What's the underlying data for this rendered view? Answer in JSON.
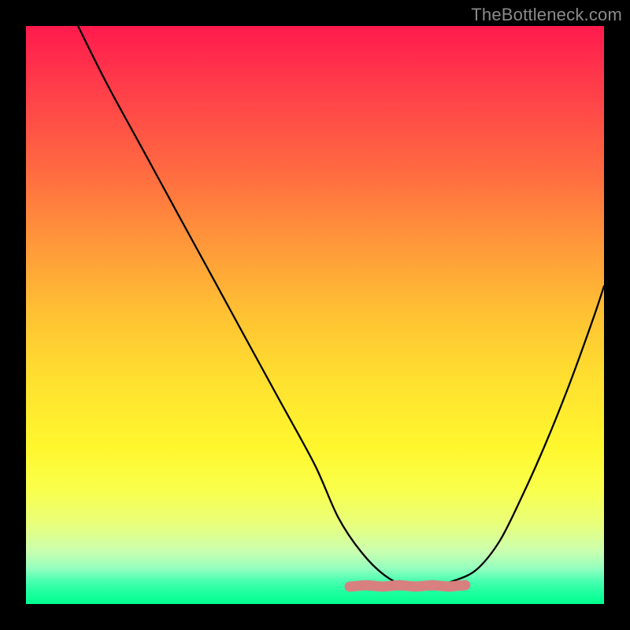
{
  "watermark": "TheBottleneck.com",
  "chart_data": {
    "type": "line",
    "title": "",
    "xlabel": "",
    "ylabel": "",
    "xlim": [
      0,
      100
    ],
    "ylim": [
      0,
      100
    ],
    "grid": false,
    "series": [
      {
        "name": "bottleneck-curve",
        "x": [
          9,
          14,
          20,
          26,
          32,
          38,
          44,
          50,
          54,
          58,
          62,
          66,
          70,
          74,
          78,
          82,
          86,
          90,
          94,
          98,
          100
        ],
        "values": [
          100,
          90,
          79,
          68,
          57,
          46,
          35,
          24,
          15,
          9,
          5,
          3,
          3,
          4,
          6,
          11,
          19,
          28,
          38,
          49,
          55
        ]
      }
    ],
    "flat_region": {
      "x_start": 56,
      "x_end": 76,
      "y": 3,
      "color": "#d88080",
      "thickness_px": 13
    },
    "background_gradient": {
      "stops": [
        {
          "pos": 0.0,
          "color": "#ff1a4d"
        },
        {
          "pos": 0.5,
          "color": "#ffc233"
        },
        {
          "pos": 0.8,
          "color": "#f9ff4a"
        },
        {
          "pos": 1.0,
          "color": "#00ff8f"
        }
      ]
    }
  }
}
